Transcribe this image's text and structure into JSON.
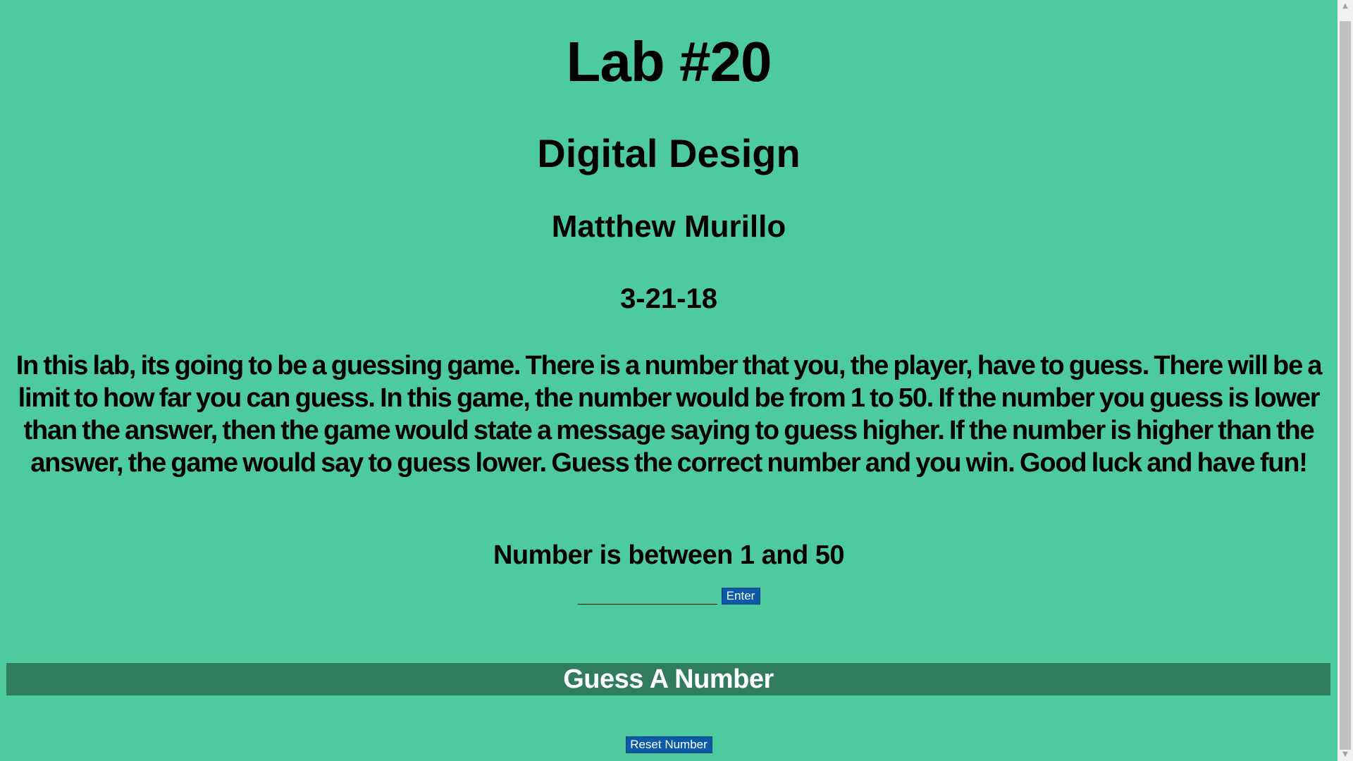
{
  "header": {
    "title": "Lab #20",
    "subtitle": "Digital Design",
    "author": "Matthew Murillo",
    "date": "3-21-18"
  },
  "description": "In this lab, its going to be a guessing game. There is a number that you, the player, have to guess. There will be a limit to how far you can guess. In this game, the number would be from 1 to 50. If the number you guess is lower than the answer, then the game would state a message saying to guess higher. If the number is higher than the answer, the game would say to guess lower. Guess the correct number and you win. Good luck and have fun!",
  "game": {
    "range_label": "Number is between 1 and 50",
    "input_value": "",
    "enter_label": "Enter",
    "banner_text": "Guess A Number",
    "reset_label": "Reset Number"
  },
  "colors": {
    "background": "#4ecb9e",
    "banner": "#317c5f",
    "button": "#0a5aa8"
  },
  "scrollbar": {
    "up_icon": "scroll-up-arrow-icon",
    "down_icon": "scroll-down-arrow-icon"
  }
}
